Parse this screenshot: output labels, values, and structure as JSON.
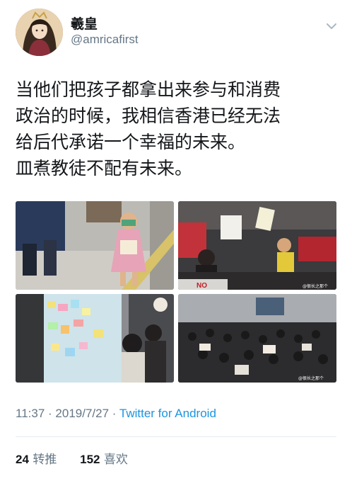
{
  "user": {
    "display_name": "羲皇",
    "handle": "@amricafirst"
  },
  "tweet": {
    "lines": [
      "当他们把孩子都拿出来参与和消费",
      "政治的时候，我相信香港已经无法",
      "给后代承诺一个幸福的未来。",
      "皿煮教徒不配有未来。"
    ]
  },
  "media": {
    "photo_2_sign_text": "NO",
    "photo_2_watermark": "@很长之那个",
    "photo_4_watermark": "@很长之那个"
  },
  "meta": {
    "time": "11:37",
    "separator_1": "·",
    "date": "2019/7/27",
    "separator_2": "·",
    "source": "Twitter for Android"
  },
  "stats": {
    "retweets_count": "24",
    "retweets_label": "转推",
    "likes_count": "152",
    "likes_label": "喜欢"
  },
  "icons": {
    "caret": "chevron-down-icon"
  },
  "colors": {
    "text": "#14171a",
    "secondary": "#657786",
    "link": "#1b95e0",
    "divider": "#e6ecf0"
  }
}
